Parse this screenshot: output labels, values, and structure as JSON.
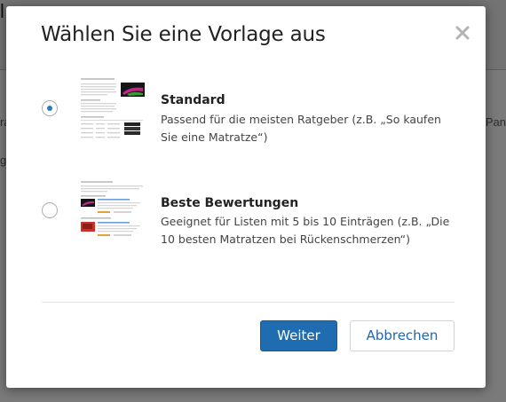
{
  "background": {
    "fragments": [
      "l",
      "ra",
      "g",
      "Pan"
    ]
  },
  "dialog": {
    "title": "Wählen Sie eine Vorlage aus",
    "close_icon": "close-icon",
    "options": [
      {
        "title": "Standard",
        "description": "Passend für die meisten Ratgeber (z.B. „So kaufen Sie eine Matratze“)",
        "selected": true
      },
      {
        "title": "Beste Bewertungen",
        "description": "Geeignet für Listen mit 5 bis 10 Einträgen (z.B. „Die 10 besten Matratzen bei Rückenschmerzen“)",
        "selected": false
      }
    ],
    "primary_label": "Weiter",
    "secondary_label": "Abbrechen"
  },
  "colors": {
    "primary": "#1f6cb0",
    "radio_checked": "#2a7ac4",
    "link": "#2067ae"
  }
}
